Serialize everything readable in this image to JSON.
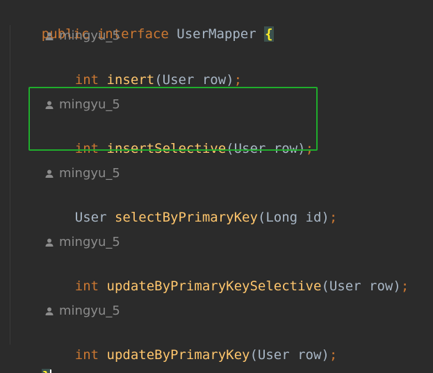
{
  "interface_decl": {
    "modifier": "public",
    "keyword": "interface",
    "name": "UserMapper",
    "open_brace": "{"
  },
  "methods": [
    {
      "author": "mingyu_5",
      "return_type": "int",
      "name": "insert",
      "open_paren": "(",
      "params": "User row",
      "close_paren": ")",
      "semicolon": ";"
    },
    {
      "author": "mingyu_5",
      "return_type": "int",
      "name": "insertSelective",
      "open_paren": "(",
      "params": "User row",
      "close_paren": ")",
      "semicolon": ";",
      "highlighted": true,
      "highlight_color": "#1fae2c"
    },
    {
      "author": "mingyu_5",
      "return_type": "User",
      "name": "selectByPrimaryKey",
      "open_paren": "(",
      "params": "Long id",
      "close_paren": ")",
      "semicolon": ";"
    },
    {
      "author": "mingyu_5",
      "return_type": "int",
      "name": "updateByPrimaryKeySelective",
      "open_paren": "(",
      "params": "User row",
      "close_paren": ")",
      "semicolon": ";"
    },
    {
      "author": "mingyu_5",
      "return_type": "int",
      "name": "updateByPrimaryKey",
      "open_paren": "(",
      "params": "User row",
      "close_paren": ")",
      "semicolon": ";"
    }
  ],
  "close_brace": "}",
  "icons": {
    "author": "user-icon"
  },
  "colors": {
    "background": "#2b2b2b",
    "keyword": "#cc7832",
    "method": "#ffc66d",
    "text": "#a9b7c6",
    "author_hint": "#8c8c8c",
    "brace_match_bg": "#3b514d",
    "brace_match_fg": "#ffef28"
  }
}
